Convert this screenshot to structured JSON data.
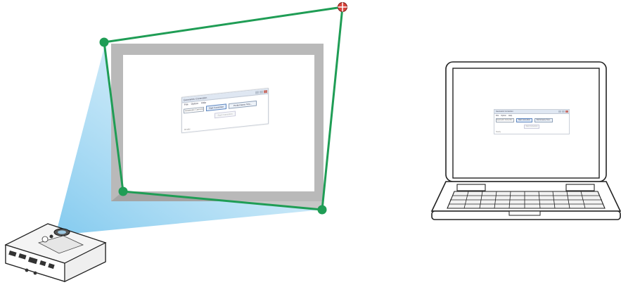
{
  "colors": {
    "frame_green": "#1f9d55",
    "screen_border": "#b9b9b9",
    "light_beam": "#9fd6f2",
    "handle_active": "#d9443c"
  },
  "icons": {
    "active_handle": "move-crosshair-icon",
    "projector": "projector-icon",
    "laptop": "laptop-icon"
  },
  "projected_app": {
    "title": "Geometric Correction",
    "menu": [
      "File",
      "Option",
      "Help"
    ],
    "select_value": "Geometric Correction",
    "start_button": "Start Correction",
    "perf_button": "Performance Test...",
    "disabled_button": "Start Correction",
    "status": "Ready"
  },
  "laptop_app": {
    "title": "Geometric Correction",
    "menu": [
      "File",
      "Option",
      "Help"
    ],
    "select_value": "Geometric Correction",
    "start_button": "Start Correction",
    "perf_button": "Performance Test...",
    "disabled_button": "Start Correction",
    "status": "Ready"
  },
  "caption": ""
}
